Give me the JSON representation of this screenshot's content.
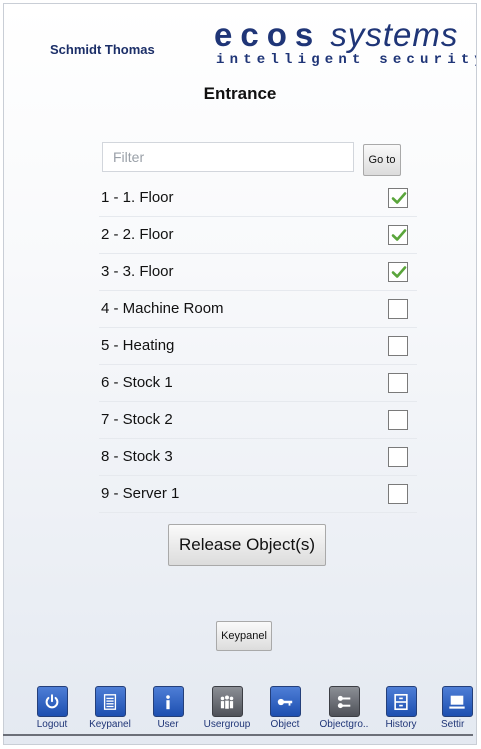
{
  "header": {
    "user_name": "Schmidt Thomas",
    "logo_ecos": "ecos",
    "logo_systems": "systems",
    "logo_tagline": "intelligent security"
  },
  "page": {
    "title": "Entrance"
  },
  "filter": {
    "placeholder": "Filter",
    "value": "",
    "go_label": "Go to"
  },
  "objects": [
    {
      "label": "1 - 1. Floor",
      "checked": true
    },
    {
      "label": "2 - 2. Floor",
      "checked": true
    },
    {
      "label": "3 - 3. Floor",
      "checked": true
    },
    {
      "label": "4 - Machine Room",
      "checked": false
    },
    {
      "label": "5 - Heating",
      "checked": false
    },
    {
      "label": "6 - Stock 1",
      "checked": false
    },
    {
      "label": "7 - Stock 2",
      "checked": false
    },
    {
      "label": "8 - Stock 3",
      "checked": false
    },
    {
      "label": "9 - Server 1",
      "checked": false
    }
  ],
  "actions": {
    "release_label": "Release Object(s)",
    "keypanel_label": "Keypanel"
  },
  "toolbar": [
    {
      "label": "Logout",
      "icon": "power-icon"
    },
    {
      "label": "Keypanel",
      "icon": "keypanel-icon"
    },
    {
      "label": "User",
      "icon": "info-icon"
    },
    {
      "label": "Usergroup",
      "icon": "usergroup-icon"
    },
    {
      "label": "Object",
      "icon": "key-icon"
    },
    {
      "label": "Objectgro..",
      "icon": "keys-icon"
    },
    {
      "label": "History",
      "icon": "cabinet-icon"
    },
    {
      "label": "Settir",
      "icon": "computer-icon"
    }
  ],
  "colors": {
    "brand": "#1f3577",
    "check": "#5aa53b"
  }
}
